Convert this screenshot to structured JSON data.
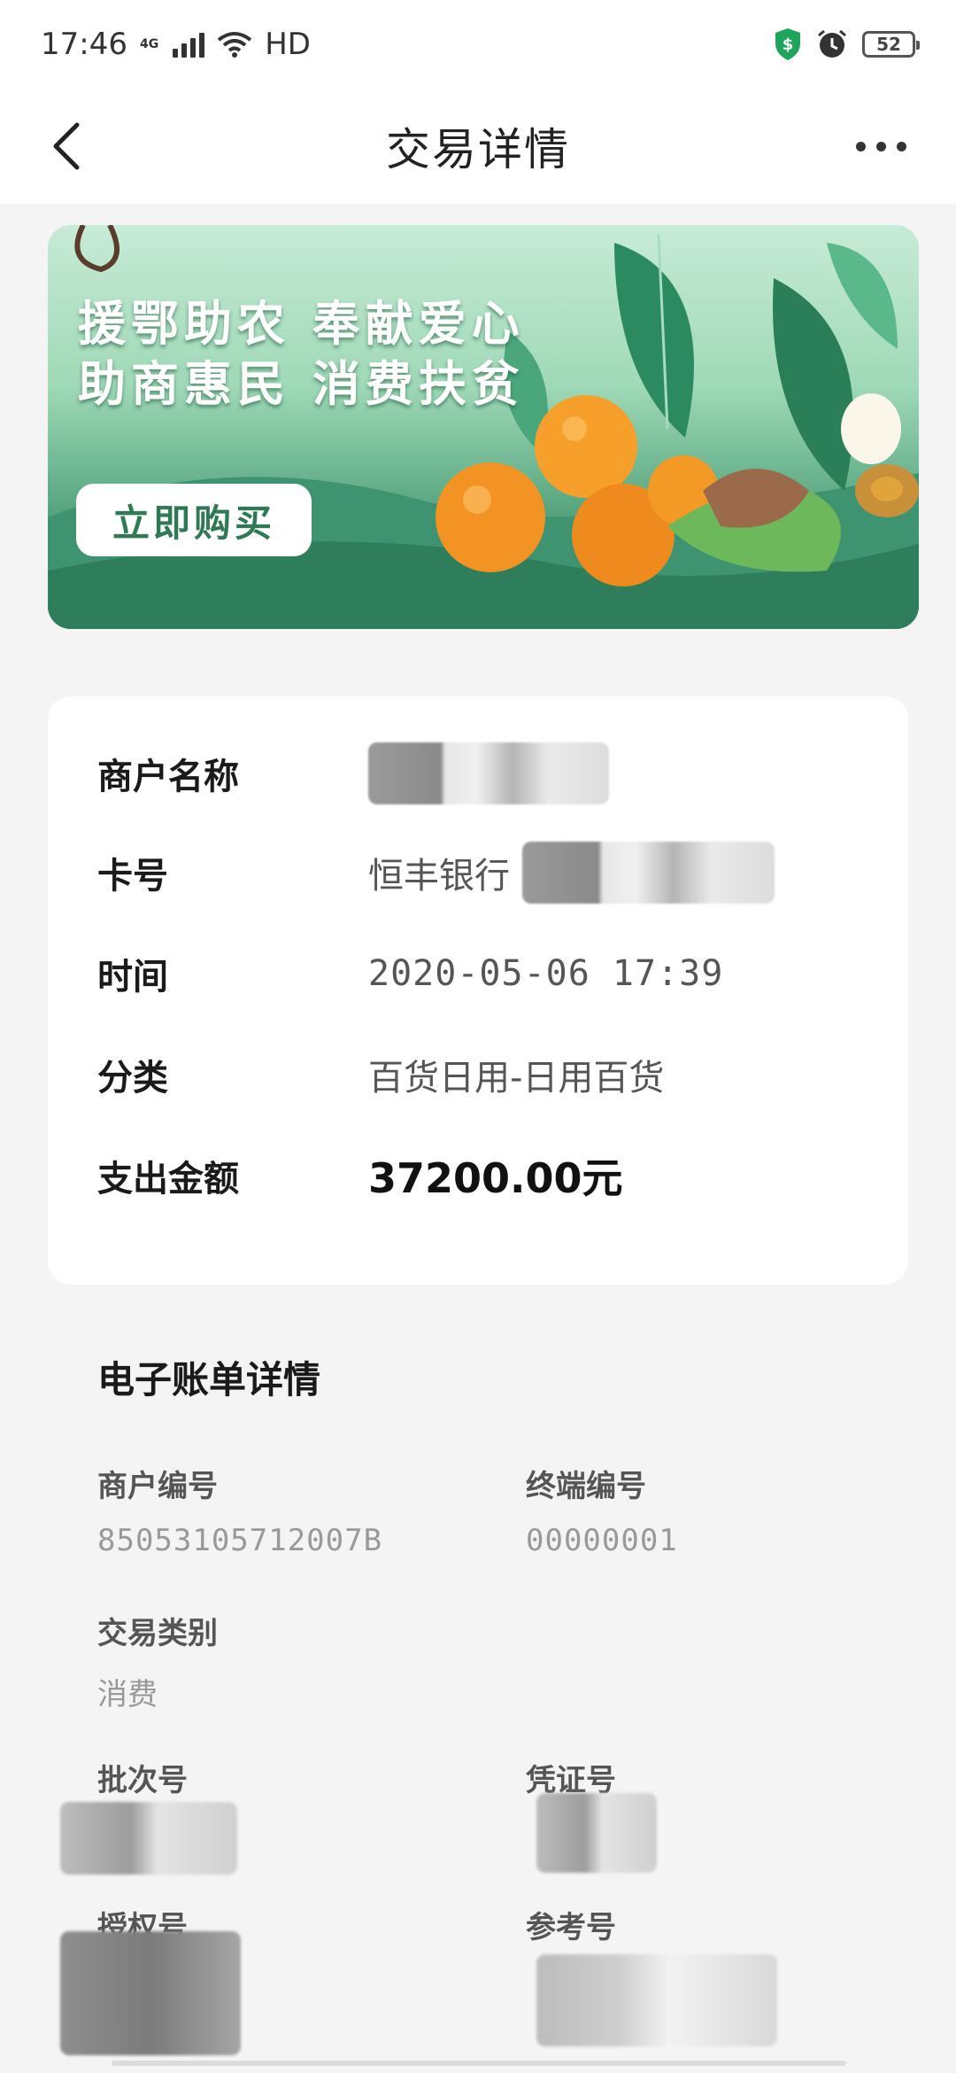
{
  "status_bar": {
    "time": "17:46",
    "network_tag": "4G",
    "hd_label": "HD",
    "battery_level": "52",
    "icons": [
      "signal-icon",
      "wifi-icon",
      "shield-icon",
      "alarm-icon",
      "battery-icon"
    ]
  },
  "nav": {
    "title": "交易详情",
    "back_icon": "chevron-left-icon",
    "more_icon": "more-dots-icon"
  },
  "banner": {
    "slogan_line1": "援鄂助农 奉献爱心",
    "slogan_line2": "助商惠民 消费扶贫",
    "button_label": "立即购买"
  },
  "transaction": {
    "merchant_label": "商户名称",
    "card_label": "卡号",
    "card_bank": "恒丰银行",
    "time_label": "时间",
    "time_value": "2020-05-06 17:39",
    "category_label": "分类",
    "category_value": "百货日用-日用百货",
    "amount_label": "支出金额",
    "amount_value": "37200.00元"
  },
  "ebill": {
    "title": "电子账单详情",
    "merchant_no_label": "商户编号",
    "merchant_no_value": "85053105712007B",
    "terminal_no_label": "终端编号",
    "terminal_no_value": "00000001",
    "txn_type_label": "交易类别",
    "txn_type_value": "消费",
    "batch_no_label": "批次号",
    "voucher_no_label": "凭证号",
    "auth_no_label": "授权号",
    "ref_no_label": "参考号"
  },
  "colors": {
    "accent_green": "#2f7a55",
    "page_bg": "#f4f4f4",
    "card_bg": "#ffffff",
    "shield_green": "#1fa55b"
  }
}
